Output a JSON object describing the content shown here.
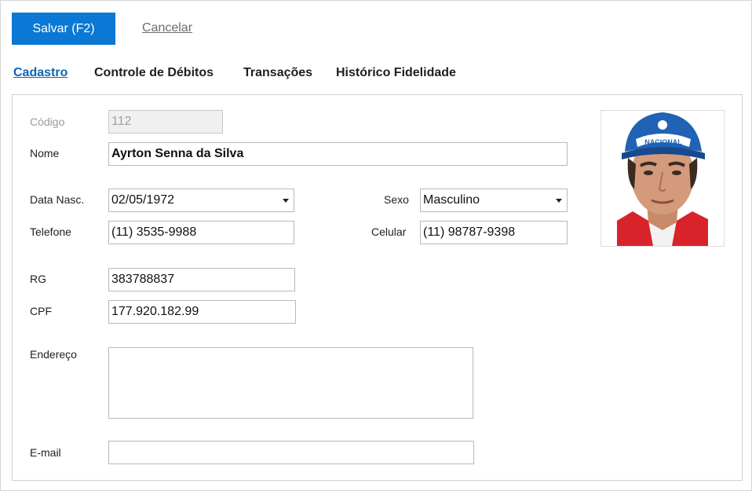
{
  "toolbar": {
    "save_label": "Salvar (F2)",
    "cancel_label": "Cancelar"
  },
  "tabs": [
    {
      "label": "Cadastro",
      "active": true
    },
    {
      "label": "Controle de Débitos",
      "active": false
    },
    {
      "label": "Transações",
      "active": false
    },
    {
      "label": "Histórico Fidelidade",
      "active": false
    }
  ],
  "form": {
    "codigo": {
      "label": "Código",
      "value": "112"
    },
    "nome": {
      "label": "Nome",
      "value": "Ayrton Senna da Silva"
    },
    "data_nasc": {
      "label": "Data Nasc.",
      "value": "02/05/1972"
    },
    "sexo": {
      "label": "Sexo",
      "value": "Masculino"
    },
    "telefone": {
      "label": "Telefone",
      "value": "(11) 3535-9988"
    },
    "celular": {
      "label": "Celular",
      "value": "(11) 98787-9398"
    },
    "rg": {
      "label": "RG",
      "value": "383788837"
    },
    "cpf": {
      "label": "CPF",
      "value": "177.920.182.99"
    },
    "endereco": {
      "label": "Endereço",
      "value": ""
    },
    "email": {
      "label": "E-mail",
      "value": ""
    }
  },
  "photo": {
    "cap_text": "NACIONAL"
  },
  "colors": {
    "accent": "#0a78d4",
    "tab_active": "#0a66b4"
  }
}
